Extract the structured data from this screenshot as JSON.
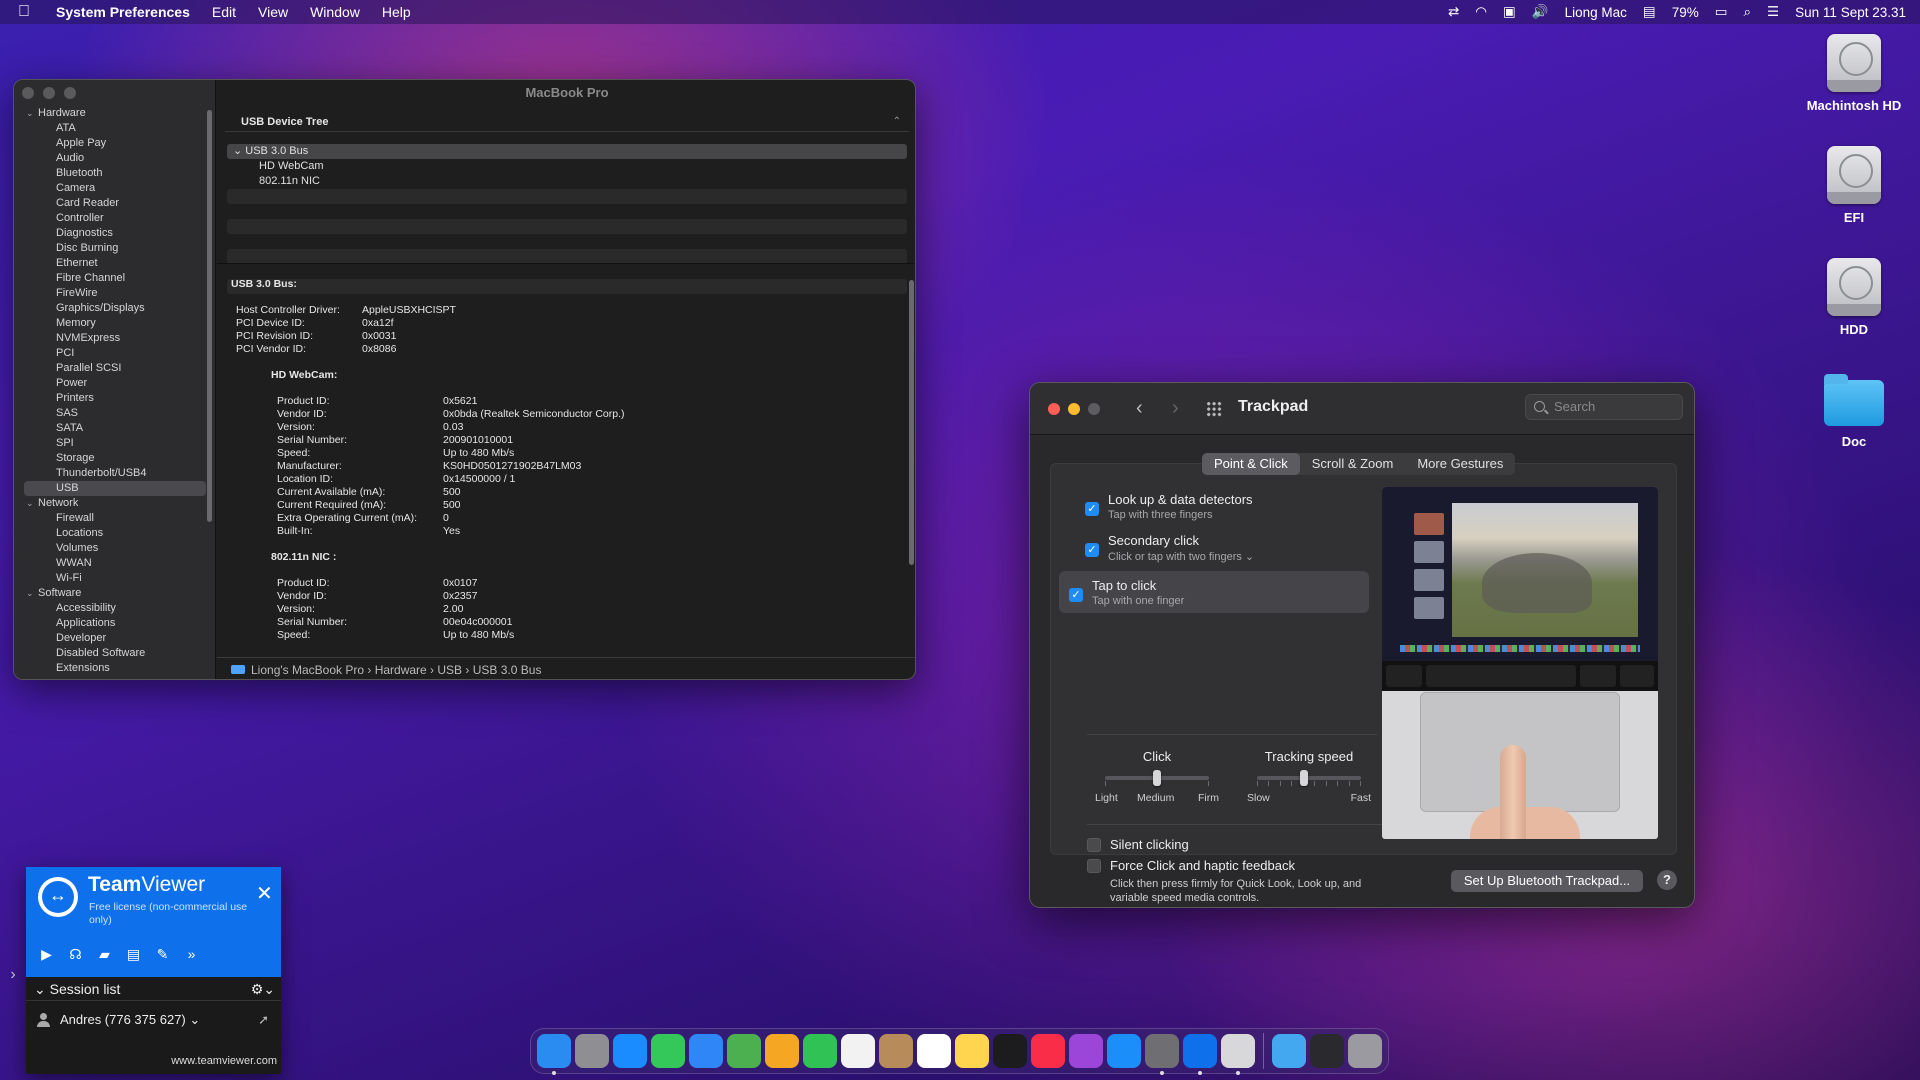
{
  "menubar": {
    "app_name": "System Preferences",
    "menus": [
      "Edit",
      "View",
      "Window",
      "Help"
    ],
    "user": "Liong Mac",
    "battery": "79%",
    "datetime": "Sun 11 Sept 23.31"
  },
  "desktop": {
    "icons": [
      {
        "label": "Machintosh HD",
        "kind": "drive"
      },
      {
        "label": "EFI",
        "kind": "drive"
      },
      {
        "label": "HDD",
        "kind": "drive"
      },
      {
        "label": "Doc",
        "kind": "folder"
      }
    ]
  },
  "sysinfo": {
    "title": "MacBook Pro",
    "sidebar": [
      {
        "label": "Hardware",
        "type": "cat"
      },
      {
        "label": "ATA"
      },
      {
        "label": "Apple Pay"
      },
      {
        "label": "Audio"
      },
      {
        "label": "Bluetooth"
      },
      {
        "label": "Camera"
      },
      {
        "label": "Card Reader"
      },
      {
        "label": "Controller"
      },
      {
        "label": "Diagnostics"
      },
      {
        "label": "Disc Burning"
      },
      {
        "label": "Ethernet"
      },
      {
        "label": "Fibre Channel"
      },
      {
        "label": "FireWire"
      },
      {
        "label": "Graphics/Displays"
      },
      {
        "label": "Memory"
      },
      {
        "label": "NVMExpress"
      },
      {
        "label": "PCI"
      },
      {
        "label": "Parallel SCSI"
      },
      {
        "label": "Power"
      },
      {
        "label": "Printers"
      },
      {
        "label": "SAS"
      },
      {
        "label": "SATA"
      },
      {
        "label": "SPI"
      },
      {
        "label": "Storage"
      },
      {
        "label": "Thunderbolt/USB4"
      },
      {
        "label": "USB",
        "selected": true
      },
      {
        "label": "Network",
        "type": "cat"
      },
      {
        "label": "Firewall"
      },
      {
        "label": "Locations"
      },
      {
        "label": "Volumes"
      },
      {
        "label": "WWAN"
      },
      {
        "label": "Wi-Fi"
      },
      {
        "label": "Software",
        "type": "cat"
      },
      {
        "label": "Accessibility"
      },
      {
        "label": "Applications"
      },
      {
        "label": "Developer"
      },
      {
        "label": "Disabled Software"
      },
      {
        "label": "Extensions"
      }
    ],
    "tree_header": "USB Device Tree",
    "tree_rows": [
      {
        "label": "USB 3.0 Bus",
        "level": 1,
        "selected": true
      },
      {
        "label": "HD WebCam",
        "level": 2
      },
      {
        "label": "802.11n NIC",
        "level": 2
      }
    ],
    "detail_heading": "USB 3.0 Bus:",
    "bus_props": [
      {
        "k": "Host Controller Driver:",
        "v": "AppleUSBXHCISPT"
      },
      {
        "k": "PCI Device ID:",
        "v": "0xa12f"
      },
      {
        "k": "PCI Revision ID:",
        "v": "0x0031"
      },
      {
        "k": "PCI Vendor ID:",
        "v": "0x8086"
      }
    ],
    "devices": [
      {
        "heading": "HD WebCam:",
        "props": [
          {
            "k": "Product ID:",
            "v": "0x5621"
          },
          {
            "k": "Vendor ID:",
            "v": "0x0bda  (Realtek Semiconductor Corp.)"
          },
          {
            "k": "Version:",
            "v": "0.03"
          },
          {
            "k": "Serial Number:",
            "v": "200901010001"
          },
          {
            "k": "Speed:",
            "v": "Up to 480 Mb/s"
          },
          {
            "k": "Manufacturer:",
            "v": "KS0HD0501271902B47LM03"
          },
          {
            "k": "Location ID:",
            "v": "0x14500000 / 1"
          },
          {
            "k": "Current Available (mA):",
            "v": "500"
          },
          {
            "k": "Current Required (mA):",
            "v": "500"
          },
          {
            "k": "Extra Operating Current (mA):",
            "v": "0"
          },
          {
            "k": "Built-In:",
            "v": "Yes"
          }
        ]
      },
      {
        "heading": "802.11n NIC :",
        "props": [
          {
            "k": "Product ID:",
            "v": "0x0107"
          },
          {
            "k": "Vendor ID:",
            "v": "0x2357"
          },
          {
            "k": "Version:",
            "v": "2.00"
          },
          {
            "k": "Serial Number:",
            "v": "00e04c000001"
          },
          {
            "k": "Speed:",
            "v": "Up to 480 Mb/s"
          }
        ]
      }
    ],
    "path": [
      "Liong's MacBook Pro",
      "Hardware",
      "USB",
      "USB 3.0 Bus"
    ]
  },
  "trackpad": {
    "title": "Trackpad",
    "search_placeholder": "Search",
    "tabs": [
      {
        "label": "Point & Click",
        "active": true
      },
      {
        "label": "Scroll & Zoom"
      },
      {
        "label": "More Gestures"
      }
    ],
    "options": [
      {
        "label": "Look up & data detectors",
        "sub": "Tap with three fingers",
        "checked": true
      },
      {
        "label": "Secondary click",
        "sub": "Click or tap with two fingers ⌄",
        "checked": true
      },
      {
        "label": "Tap to click",
        "sub": "Tap with one finger",
        "checked": true,
        "highlighted": true
      }
    ],
    "click_slider": {
      "title": "Click",
      "labels": [
        "Light",
        "Medium",
        "Firm"
      ],
      "value": 0.5
    },
    "speed_slider": {
      "title": "Tracking speed",
      "labels": [
        "Slow",
        "Fast"
      ],
      "value": 0.45
    },
    "lower_options": [
      {
        "label": "Silent clicking",
        "checked": false
      },
      {
        "label": "Force Click and haptic feedback",
        "checked": false,
        "sub": "Click then press firmly for Quick Look, Look up, and variable speed media controls."
      }
    ],
    "setup_button": "Set Up Bluetooth Trackpad...",
    "help": "?"
  },
  "teamviewer": {
    "brand_bold": "Team",
    "brand_rest": "Viewer",
    "license": "Free license (non-commercial use only)",
    "session_label": "Session list",
    "contact": "Andres (776 375 627) ⌄",
    "url": "www.teamviewer.com"
  },
  "dock": {
    "apps": [
      {
        "name": "finder",
        "color": "#2a8cf0",
        "running": true
      },
      {
        "name": "launchpad",
        "color": "#8e8e93"
      },
      {
        "name": "safari",
        "color": "#1a8cff"
      },
      {
        "name": "messages",
        "color": "#34c759"
      },
      {
        "name": "mail",
        "color": "#2f86f6"
      },
      {
        "name": "maps",
        "color": "#4caf50"
      },
      {
        "name": "photos",
        "color": "#f5a623"
      },
      {
        "name": "facetime",
        "color": "#30c254"
      },
      {
        "name": "calendar",
        "color": "#f2f2f2"
      },
      {
        "name": "contacts",
        "color": "#b78b5a"
      },
      {
        "name": "reminders",
        "color": "#ffffff"
      },
      {
        "name": "notes",
        "color": "#ffd54f"
      },
      {
        "name": "tv",
        "color": "#1c1c1e"
      },
      {
        "name": "music",
        "color": "#fa2d48"
      },
      {
        "name": "podcasts",
        "color": "#9b45d9"
      },
      {
        "name": "app-store",
        "color": "#1c8ef9"
      },
      {
        "name": "system-preferences",
        "color": "#6e6e73",
        "running": true
      },
      {
        "name": "teamviewer",
        "color": "#0e71eb",
        "running": true
      },
      {
        "name": "printer",
        "color": "#d8d8da",
        "running": true
      }
    ],
    "right": [
      {
        "name": "downloads",
        "color": "#43a8f0"
      },
      {
        "name": "screen",
        "color": "#2a2a2e"
      },
      {
        "name": "trash",
        "color": "#9a9aa0"
      }
    ]
  }
}
